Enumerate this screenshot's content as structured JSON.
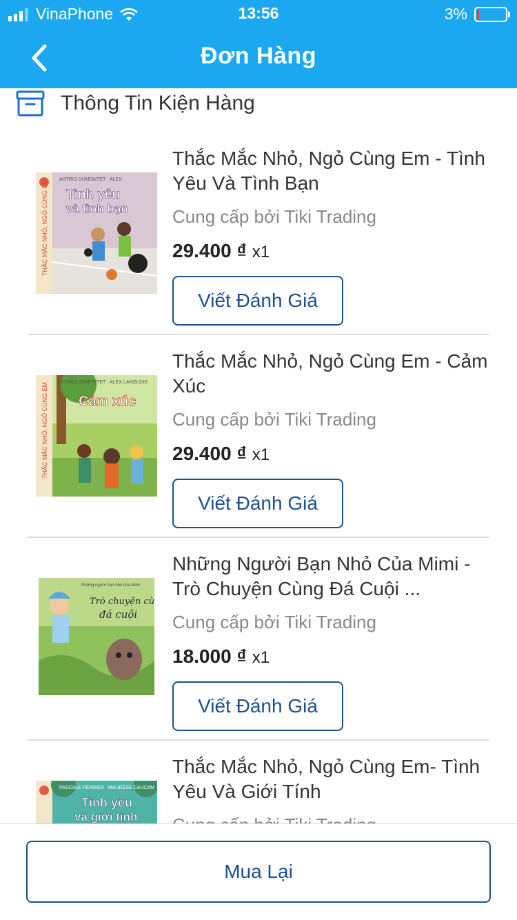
{
  "status_bar": {
    "carrier": "VinaPhone",
    "time": "13:56",
    "battery": "3%",
    "signal_icon": "signal-icon",
    "wifi_icon": "wifi-icon",
    "battery_icon": "battery-icon"
  },
  "nav": {
    "title": "Đơn Hàng",
    "back_icon": "chevron-left-icon"
  },
  "section": {
    "title": "Thông Tin Kiện Hàng",
    "icon": "package-box-icon"
  },
  "colors": {
    "header_bg": "#1ba8f0",
    "button_border": "#1d4f8f",
    "seller_text": "#888888"
  },
  "items": [
    {
      "title": "Thắc Mắc Nhỏ, Ngỏ Cùng Em - Tình Yêu Và Tình Bạn",
      "seller": "Cung cấp bởi Tiki Trading",
      "price": "29.400 ₫",
      "qty": "x1",
      "review_label": "Viết Đánh Giá",
      "cover_text": "Tình yêu và tình bạn",
      "cover_series": "THẮC MẮC NHỎ, NGỎ CÙNG EM"
    },
    {
      "title": "Thắc Mắc Nhỏ, Ngỏ Cùng Em - Cảm Xúc",
      "seller": "Cung cấp bởi Tiki Trading",
      "price": "29.400 ₫",
      "qty": "x1",
      "review_label": "Viết Đánh Giá",
      "cover_text": "Cảm xúc",
      "cover_series": "THẮC MẮC NHỎ, NGỎ CÙNG EM"
    },
    {
      "title": "Những Người Bạn Nhỏ Của Mimi - Trò Chuyện Cùng Đá Cuội ...",
      "seller": "Cung cấp bởi Tiki Trading",
      "price": "18.000 ₫",
      "qty": "x1",
      "review_label": "Viết Đánh Giá",
      "cover_text": "Trò chuyện cùng đá cuội"
    },
    {
      "title": "Thắc Mắc Nhỏ, Ngỏ Cùng Em- Tình Yêu Và Giới Tính",
      "seller": "Cung cấp bởi Tiki Trading",
      "price": "",
      "qty": "",
      "review_label": "",
      "cover_text": "Tình yêu và giới tính"
    }
  ],
  "bottom": {
    "rebuy_label": "Mua Lại"
  }
}
